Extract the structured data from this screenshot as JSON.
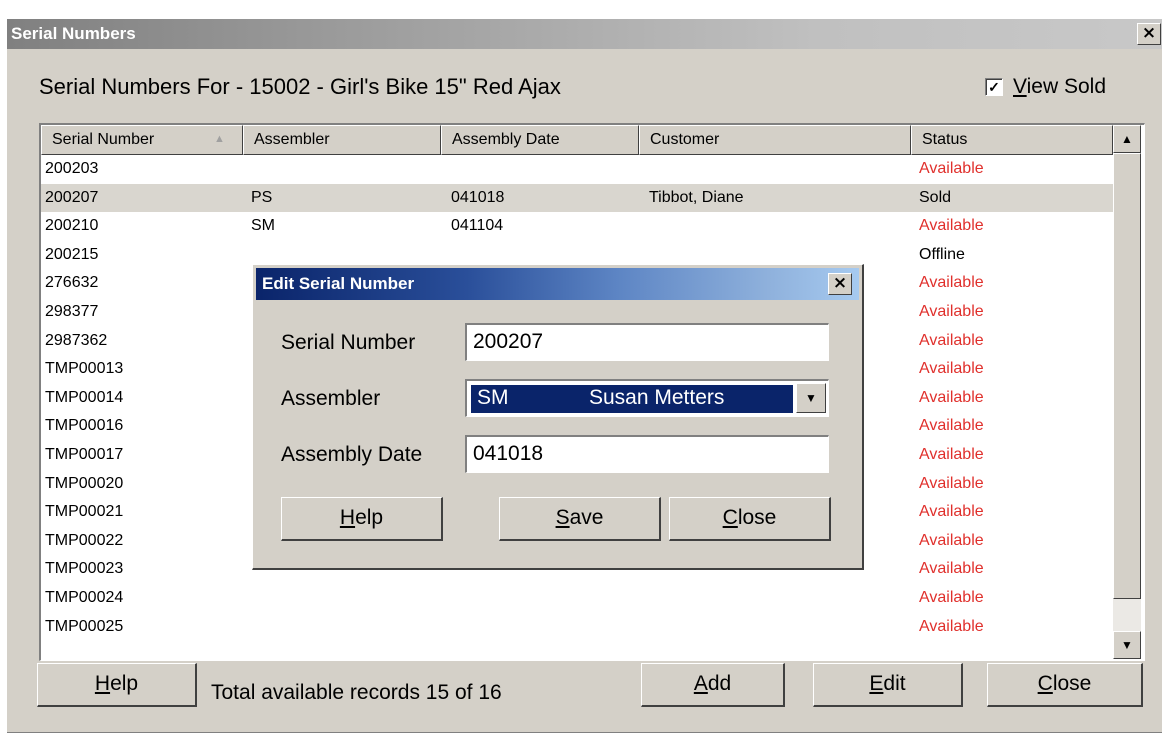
{
  "window": {
    "title": "Serial Numbers",
    "close_glyph": "×"
  },
  "heading": "Serial Numbers For  -  15002 - Girl's Bike 15\" Red Ajax",
  "view_sold": {
    "checked_glyph": "✓",
    "label_prefix": "",
    "label_ul": "V",
    "label_rest": "iew Sold"
  },
  "columns": [
    "Serial Number",
    "Assembler",
    "Assembly Date",
    "Customer",
    "Status"
  ],
  "sort_indicator": "▲",
  "rows": [
    {
      "serial": "200203",
      "assembler": "",
      "date": "",
      "customer": "",
      "status": "Available"
    },
    {
      "serial": "200207",
      "assembler": "PS",
      "date": "041018",
      "customer": "Tibbot, Diane",
      "status": "Sold"
    },
    {
      "serial": "200210",
      "assembler": "SM",
      "date": "041104",
      "customer": "",
      "status": "Available"
    },
    {
      "serial": "200215",
      "assembler": "",
      "date": "",
      "customer": "",
      "status": "Offline"
    },
    {
      "serial": "276632",
      "assembler": "",
      "date": "",
      "customer": "",
      "status": "Available"
    },
    {
      "serial": "298377",
      "assembler": "",
      "date": "",
      "customer": "",
      "status": "Available"
    },
    {
      "serial": "2987362",
      "assembler": "",
      "date": "",
      "customer": "",
      "status": "Available"
    },
    {
      "serial": "TMP00013",
      "assembler": "",
      "date": "",
      "customer": "",
      "status": "Available"
    },
    {
      "serial": "TMP00014",
      "assembler": "",
      "date": "",
      "customer": "",
      "status": "Available"
    },
    {
      "serial": "TMP00016",
      "assembler": "",
      "date": "",
      "customer": "",
      "status": "Available"
    },
    {
      "serial": "TMP00017",
      "assembler": "",
      "date": "",
      "customer": "",
      "status": "Available"
    },
    {
      "serial": "TMP00020",
      "assembler": "",
      "date": "",
      "customer": "",
      "status": "Available"
    },
    {
      "serial": "TMP00021",
      "assembler": "",
      "date": "",
      "customer": "",
      "status": "Available"
    },
    {
      "serial": "TMP00022",
      "assembler": "",
      "date": "",
      "customer": "",
      "status": "Available"
    },
    {
      "serial": "TMP00023",
      "assembler": "",
      "date": "",
      "customer": "",
      "status": "Available"
    },
    {
      "serial": "TMP00024",
      "assembler": "",
      "date": "",
      "customer": "",
      "status": "Available"
    },
    {
      "serial": "TMP00025",
      "assembler": "",
      "date": "",
      "customer": "",
      "status": "Available"
    }
  ],
  "selected_row": 1,
  "scroll": {
    "up_glyph": "▲",
    "down_glyph": "▼"
  },
  "footer": {
    "help": {
      "ul": "H",
      "rest": "elp"
    },
    "total": "Total available records 15 of 16",
    "add": {
      "ul": "A",
      "rest": "dd"
    },
    "edit": {
      "ul": "E",
      "rest": "dit"
    },
    "close": {
      "ul": "C",
      "rest": "lose"
    }
  },
  "dialog": {
    "title": "Edit Serial Number",
    "close_glyph": "×",
    "serial_label": "Serial Number",
    "serial_value": "200207",
    "assembler_label": "Assembler",
    "assembler_code": "SM",
    "assembler_name": "Susan Metters",
    "combo_arrow": "▼",
    "date_label": "Assembly Date",
    "date_value": "041018",
    "help": {
      "ul": "H",
      "rest": "elp"
    },
    "save": {
      "ul": "S",
      "rest": "ave"
    },
    "close": {
      "ul": "C",
      "rest": "lose"
    }
  },
  "colors": {
    "available": "#e0302c",
    "selection": "#0a246a",
    "face": "#d4d0c8"
  }
}
